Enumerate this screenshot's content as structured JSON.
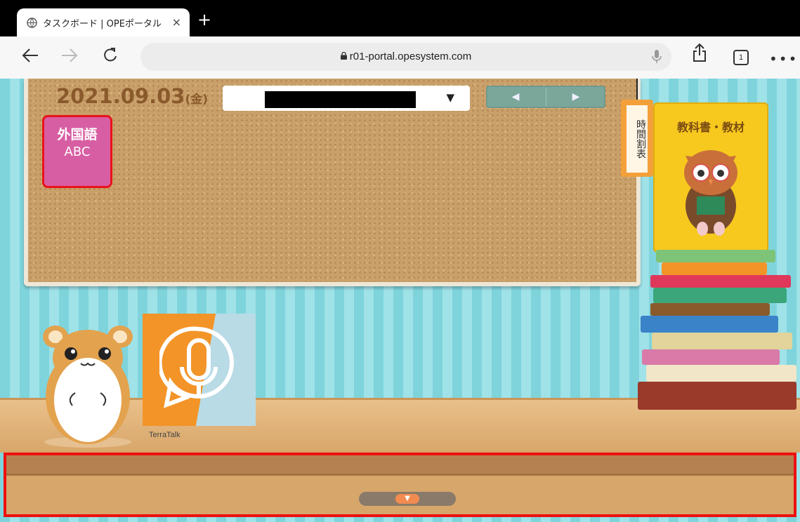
{
  "browser": {
    "tab_title": "タスクボード | OPEポータル",
    "tab_close": "×",
    "new_tab": "+",
    "url": "r01-portal.opesystem.com",
    "tab_count": "1",
    "more": "•••"
  },
  "board": {
    "date": "2021.09.03",
    "weekday": "(金)",
    "select_caret": "▼",
    "prev": "◀",
    "next": "▶"
  },
  "tiles": {
    "language_label": "外国語",
    "language_abc": "ABC",
    "timetable_label": "時間割表",
    "textbook_label": "教科書・教材",
    "app_label": "TerraTalk"
  },
  "drawer": {
    "toggle": "▼"
  },
  "colors": {
    "accent_red": "#ee1010",
    "tile_pink": "#d85ea3",
    "book_yellow": "#f7c81e",
    "terratalk_orange": "#f39428"
  }
}
